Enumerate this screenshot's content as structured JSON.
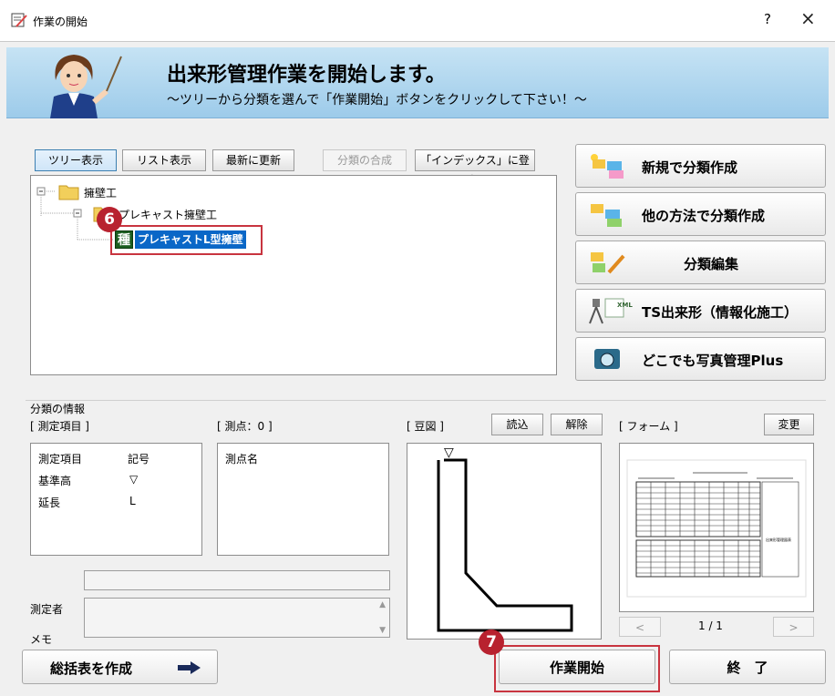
{
  "window": {
    "title": "作業の開始",
    "help": "?",
    "close": "×"
  },
  "banner": {
    "heading": "出来形管理作業を開始します。",
    "subheading": "～ツリーから分類を選んで「作業開始」ボタンをクリックして下さい！～"
  },
  "toolbar": {
    "tree_view": "ツリー表示",
    "list_view": "リスト表示",
    "refresh": "最新に更新",
    "merge": "分類の合成",
    "register_index": "「インデックス」に登録"
  },
  "tree": {
    "root": "擁壁工",
    "child": "プレキャスト擁壁工",
    "leaf_badge": "種",
    "leaf": "プレキャストL型擁壁"
  },
  "actions": {
    "new_category": "新規で分類作成",
    "other_method": "他の方法で分類作成",
    "edit_category": "分類編集",
    "ts": "TS出来形（情報化施工）",
    "photo": "どこでも写真管理Plus",
    "xml_tag": "XML"
  },
  "info": {
    "section_label": "分類の情報",
    "measure_items_label": "[ 測定項目 ]",
    "measure_columns": [
      "測定項目",
      "記号"
    ],
    "measure_rows": [
      [
        "基準高",
        "▽"
      ],
      [
        "延長",
        "L"
      ]
    ],
    "points_label": "[ 測点：0 ]",
    "points_column": "測点名",
    "sketch_label": "[ 豆図 ]",
    "load": "読込",
    "release": "解除",
    "form_label": "[ フォーム ]",
    "change": "変更",
    "form_page": "1 / 1",
    "prev": "<",
    "next": ">",
    "form_note": "出来形管理図表",
    "measurer_label": "測定者",
    "memo_label": "メモ"
  },
  "footer": {
    "summary": "総括表を作成",
    "start": "作業開始",
    "end": "終　了"
  },
  "callouts": {
    "first": "6",
    "second": "7"
  }
}
